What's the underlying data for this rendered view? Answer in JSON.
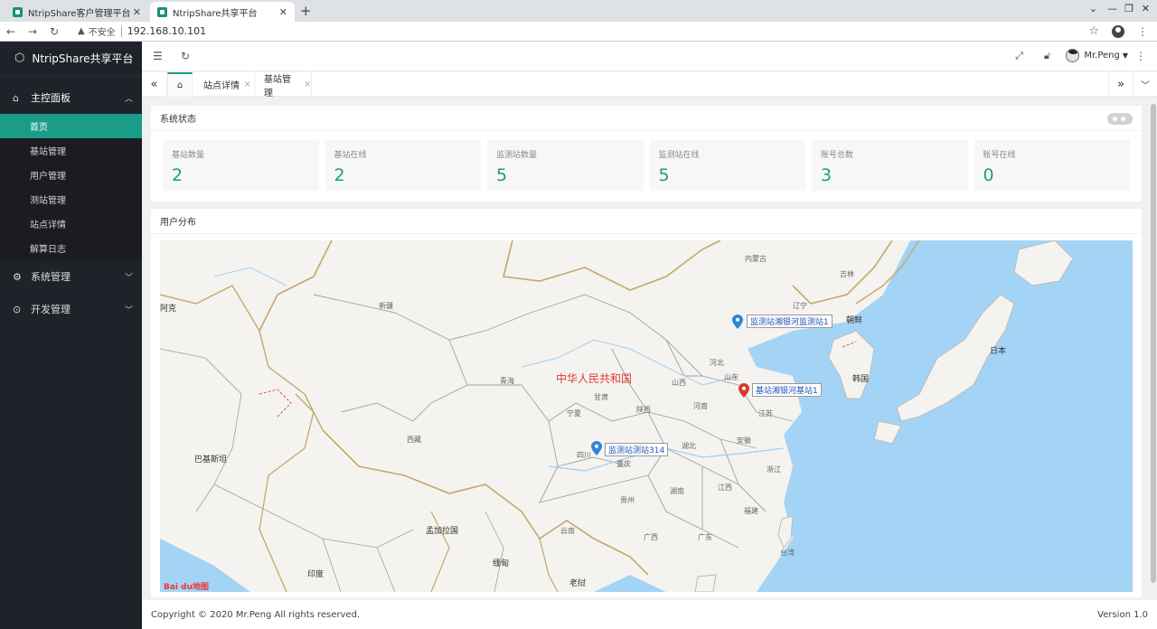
{
  "browser": {
    "tabs": [
      {
        "title": "NtripShare客户管理平台"
      },
      {
        "title": "NtripShare共享平台"
      }
    ],
    "security": "不安全",
    "url": "192.168.10.101"
  },
  "sidebar": {
    "brand": "NtripShare共享平台",
    "main_group": "主控面板",
    "items": [
      {
        "label": "首页"
      },
      {
        "label": "基站管理"
      },
      {
        "label": "用户管理"
      },
      {
        "label": "测站管理"
      },
      {
        "label": "站点详情"
      },
      {
        "label": "解算日志"
      }
    ],
    "groups": [
      {
        "label": "系统管理"
      },
      {
        "label": "开发管理"
      }
    ]
  },
  "header": {
    "user": "Mr.Peng"
  },
  "pagetabs": [
    {
      "label": "站点详情"
    },
    {
      "label": "基站管理"
    }
  ],
  "status": {
    "title": "系统状态",
    "stats": [
      {
        "label": "基站数量",
        "value": "2"
      },
      {
        "label": "基站在线",
        "value": "2"
      },
      {
        "label": "监测站数量",
        "value": "5"
      },
      {
        "label": "监测站在线",
        "value": "5"
      },
      {
        "label": "账号总数",
        "value": "3"
      },
      {
        "label": "账号在线",
        "value": "0"
      }
    ]
  },
  "map": {
    "title": "用户分布",
    "country": "中华人民共和国",
    "labels": {
      "xinjiang": "新疆",
      "qinghai": "青海",
      "xizang": "西藏",
      "gansu": "甘肃",
      "shaanxi": "陕西",
      "shanxi": "山西",
      "hebei": "河北",
      "henan": "河南",
      "shandong": "山东",
      "jiangsu": "江苏",
      "anhui": "安徽",
      "hubei": "湖北",
      "sichuan": "四川",
      "chongqing": "重庆",
      "guizhou": "贵州",
      "hunan": "湖南",
      "jiangxi": "江西",
      "zhejiang": "浙江",
      "fujian": "福建",
      "yunnan": "云南",
      "guangxi": "广西",
      "guangdong": "广东",
      "neimenggu": "内蒙古",
      "liaoning": "辽宁",
      "jilin": "吉林",
      "ningxia": "宁夏",
      "taiwan": "台湾",
      "pakistan": "巴基斯坦",
      "bangladesh": "孟加拉国",
      "india": "印度",
      "myanmar": "缅甸",
      "laos": "老挝",
      "korea_n": "朝鲜",
      "korea_s": "韩国",
      "japan": "日本",
      "afgh": "阿克"
    },
    "markers": [
      {
        "label": "监测站湘银河监测站1",
        "color": "#2f86d6"
      },
      {
        "label": "基站湘银河基站1",
        "color": "#d63a2f"
      },
      {
        "label": "监测站测站314",
        "color": "#2f86d6"
      }
    ],
    "logo": "Bai du地图"
  },
  "footer": {
    "copyright": "Copyright © 2020 Mr.Peng All rights reserved.",
    "version": "Version 1.0"
  }
}
